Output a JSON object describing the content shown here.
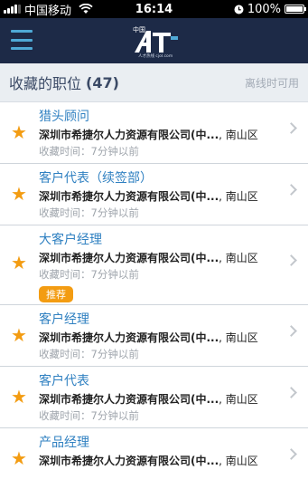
{
  "status_bar": {
    "carrier": "中国移动",
    "time": "16:14",
    "battery": "100%"
  },
  "nav": {
    "logo_text": "中国人才热线"
  },
  "section": {
    "title": "收藏的职位",
    "count": "(47)",
    "offline": "离线时可用"
  },
  "items": [
    {
      "title": "猎头顾问",
      "company": "深圳市希捷尔人力资源有限公司(中...",
      "district": ", 南山区",
      "saved": "收藏时间：7分钟以前"
    },
    {
      "title": "客户代表（续签部）",
      "company": "深圳市希捷尔人力资源有限公司(中...",
      "district": ", 南山区",
      "saved": "收藏时间：7分钟以前"
    },
    {
      "title": "大客户经理",
      "company": "深圳市希捷尔人力资源有限公司(中...",
      "district": ", 南山区",
      "saved": "收藏时间：7分钟以前",
      "badge": "推荐"
    },
    {
      "title": "客户经理",
      "company": "深圳市希捷尔人力资源有限公司(中...",
      "district": ", 南山区",
      "saved": "收藏时间：7分钟以前"
    },
    {
      "title": "客户代表",
      "company": "深圳市希捷尔人力资源有限公司(中...",
      "district": ", 南山区",
      "saved": "收藏时间：7分钟以前"
    },
    {
      "title": "产品经理",
      "company": "深圳市希捷尔人力资源有限公司(中...",
      "district": ", 南山区",
      "saved": ""
    }
  ],
  "colors": {
    "nav_bg": "#1d2a47",
    "accent_blue": "#2f80c1",
    "star_orange": "#f39c12"
  }
}
